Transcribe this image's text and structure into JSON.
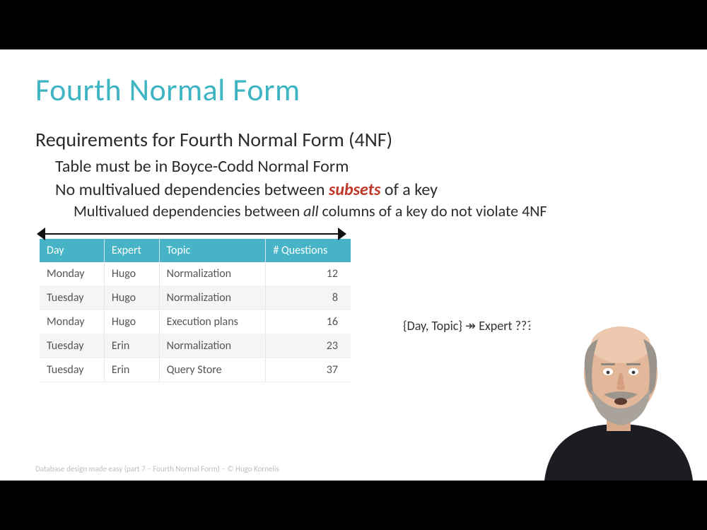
{
  "slide": {
    "title": "Fourth Normal Form",
    "req_head": "Requirements for Fourth Normal Form (4NF)",
    "req1": "Table must be in Boyce-Codd Normal Form",
    "req2_pre": "No multivalued dependencies between ",
    "req2_em": "subsets",
    "req2_post": " of a key",
    "req3_pre": "Multivalued dependencies between ",
    "req3_em": "all",
    "req3_post": " columns of a key do not violate 4NF",
    "annotation": "{Day, Topic} ↠ Expert ?????",
    "footer": "Database design made easy (part 7 – Fourth Normal Form) – © Hugo Kornelis"
  },
  "table": {
    "headers": [
      "Day",
      "Expert",
      "Topic",
      "# Questions"
    ],
    "rows": [
      [
        "Monday",
        "Hugo",
        "Normalization",
        "12"
      ],
      [
        "Tuesday",
        "Hugo",
        "Normalization",
        "8"
      ],
      [
        "Monday",
        "Hugo",
        "Execution plans",
        "16"
      ],
      [
        "Tuesday",
        "Erin",
        "Normalization",
        "23"
      ],
      [
        "Tuesday",
        "Erin",
        "Query Store",
        "37"
      ]
    ]
  }
}
